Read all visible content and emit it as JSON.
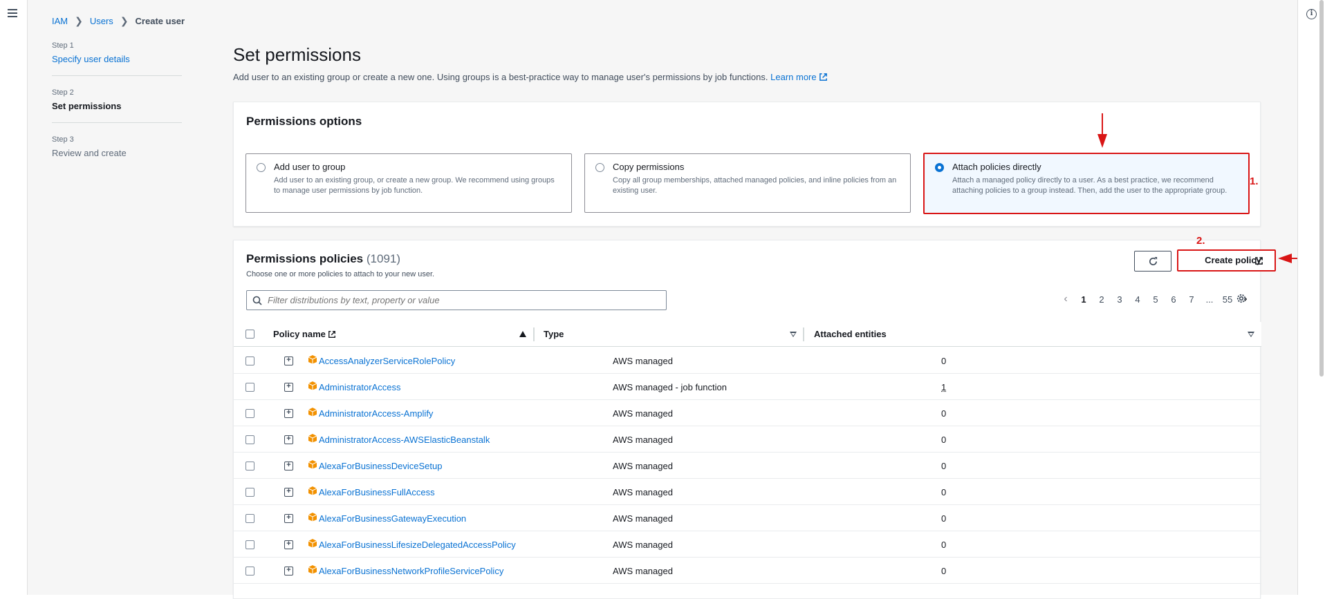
{
  "breadcrumb": {
    "items": [
      "IAM",
      "Users"
    ],
    "current": "Create user"
  },
  "steps": [
    {
      "num": "Step 1",
      "label": "Specify user details"
    },
    {
      "num": "Step 2",
      "label": "Set permissions"
    },
    {
      "num": "Step 3",
      "label": "Review and create"
    }
  ],
  "page": {
    "title": "Set permissions",
    "subtitle": "Add user to an existing group or create a new one. Using groups is a best-practice way to manage user's permissions by job functions.",
    "learn_more": "Learn more"
  },
  "permissions_options": {
    "title": "Permissions options",
    "options": [
      {
        "label": "Add user to group",
        "desc": "Add user to an existing group, or create a new group. We recommend using groups to manage user permissions by job function.",
        "selected": false
      },
      {
        "label": "Copy permissions",
        "desc": "Copy all group memberships, attached managed policies, and inline policies from an existing user.",
        "selected": false
      },
      {
        "label": "Attach policies directly",
        "desc": "Attach a managed policy directly to a user. As a best practice, we recommend attaching policies to a group instead. Then, add the user to the appropriate group.",
        "selected": true
      }
    ]
  },
  "annotations": {
    "step1": "1.",
    "step2": "2.",
    "color": "#d91515"
  },
  "policies": {
    "title": "Permissions policies",
    "count": "(1091)",
    "desc": "Choose one or more policies to attach to your new user.",
    "create_label": "Create policy",
    "filter_placeholder": "Filter distributions by text, property or value",
    "pages": [
      "1",
      "2",
      "3",
      "4",
      "5",
      "6",
      "7",
      "...",
      "55"
    ],
    "current_page": "1",
    "columns": {
      "name": "Policy name",
      "type": "Type",
      "entities": "Attached entities"
    },
    "rows": [
      {
        "name": "AccessAnalyzerServiceRolePolicy",
        "type": "AWS managed",
        "entities": "0"
      },
      {
        "name": "AdministratorAccess",
        "type": "AWS managed - job function",
        "entities": "1"
      },
      {
        "name": "AdministratorAccess-Amplify",
        "type": "AWS managed",
        "entities": "0"
      },
      {
        "name": "AdministratorAccess-AWSElasticBeanstalk",
        "type": "AWS managed",
        "entities": "0"
      },
      {
        "name": "AlexaForBusinessDeviceSetup",
        "type": "AWS managed",
        "entities": "0"
      },
      {
        "name": "AlexaForBusinessFullAccess",
        "type": "AWS managed",
        "entities": "0"
      },
      {
        "name": "AlexaForBusinessGatewayExecution",
        "type": "AWS managed",
        "entities": "0"
      },
      {
        "name": "AlexaForBusinessLifesizeDelegatedAccessPolicy",
        "type": "AWS managed",
        "entities": "0"
      },
      {
        "name": "AlexaForBusinessNetworkProfileServicePolicy",
        "type": "AWS managed",
        "entities": "0"
      }
    ]
  },
  "colors": {
    "link": "#0972d3",
    "accent": "#0972d3",
    "highlight": "#d91515",
    "package": "#f29100"
  },
  "icons": [
    "menu-icon",
    "info-icon",
    "external-link-icon",
    "refresh-icon",
    "search-icon",
    "gear-icon",
    "expand-icon",
    "package-icon",
    "chevron-left-icon",
    "chevron-right-icon",
    "sort-asc-icon",
    "sort-desc-icon"
  ]
}
